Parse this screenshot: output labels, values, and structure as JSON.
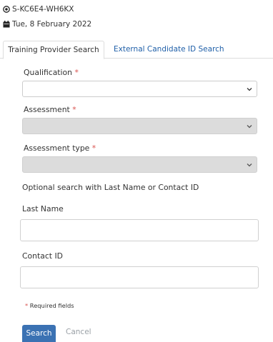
{
  "header": {
    "reference": "S-KC6E4-WH6KX",
    "reference_icon": "target-icon",
    "date": "Tue, 8 February 2022",
    "date_icon": "calendar-icon"
  },
  "tabs": [
    {
      "label": "Training Provider Search",
      "active": true
    },
    {
      "label": "External Candidate ID Search",
      "active": false
    }
  ],
  "form": {
    "qualification": {
      "label": "Qualification",
      "required": "*",
      "value": ""
    },
    "assessment": {
      "label": "Assessment",
      "required": "*",
      "value": "",
      "disabled": true
    },
    "assessment_type": {
      "label": "Assessment type",
      "required": "*",
      "value": "",
      "disabled": true
    },
    "optional_note": "Optional search with Last Name or Contact ID",
    "last_name": {
      "label": "Last Name",
      "value": ""
    },
    "contact_id": {
      "label": "Contact ID",
      "value": ""
    },
    "required_note": {
      "asterisk": "*",
      "text": "Required fields"
    }
  },
  "actions": {
    "search_label": "Search",
    "cancel_label": "Cancel"
  },
  "colors": {
    "link": "#1f5fa8",
    "required": "#d9534f",
    "primary_button": "#3b72b3",
    "disabled_select": "#dcdcdc"
  }
}
